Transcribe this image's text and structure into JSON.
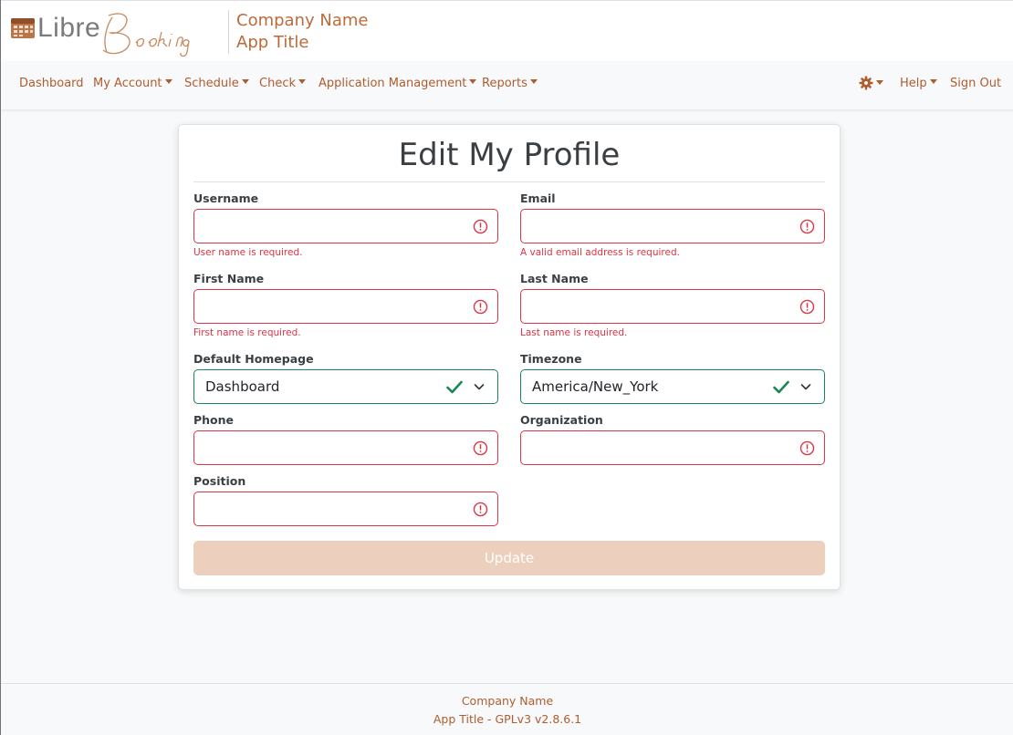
{
  "header": {
    "logo": {
      "brand_plain": "Libre",
      "brand_script": "Booking",
      "icon": "calendar-icon"
    },
    "company_name": "Company Name",
    "app_title": "App Title"
  },
  "nav": {
    "left": [
      {
        "label": "Dashboard",
        "dropdown": false
      },
      {
        "label": "My Account",
        "dropdown": true
      },
      {
        "label": "Schedule",
        "dropdown": true
      },
      {
        "label": "Check",
        "dropdown": true
      },
      {
        "label": "Application Management",
        "dropdown": true
      },
      {
        "label": "Reports",
        "dropdown": true
      }
    ],
    "right": {
      "settings_icon": "gear-icon",
      "help": "Help",
      "sign_out": "Sign Out"
    }
  },
  "form": {
    "title": "Edit My Profile",
    "fields": {
      "username": {
        "label": "Username",
        "value": "",
        "state": "invalid",
        "error": "User name is required."
      },
      "email": {
        "label": "Email",
        "value": "",
        "state": "invalid",
        "error": "A valid email address is required."
      },
      "first_name": {
        "label": "First Name",
        "value": "",
        "state": "invalid",
        "error": "First name is required."
      },
      "last_name": {
        "label": "Last Name",
        "value": "",
        "state": "invalid",
        "error": "Last name is required."
      },
      "default_homepage": {
        "label": "Default Homepage",
        "value": "Dashboard",
        "state": "valid"
      },
      "timezone": {
        "label": "Timezone",
        "value": "America/New_York",
        "state": "valid"
      },
      "phone": {
        "label": "Phone",
        "value": "",
        "state": "invalid"
      },
      "organization": {
        "label": "Organization",
        "value": "",
        "state": "invalid"
      },
      "position": {
        "label": "Position",
        "value": "",
        "state": "invalid"
      }
    },
    "submit_label": "Update"
  },
  "footer": {
    "company": "Company Name",
    "app_version": "App Title - GPLv3 v2.8.6.1"
  },
  "colors": {
    "accent": "#b05c2e",
    "invalid": "#dc3545",
    "valid": "#198754",
    "button_disabled": "#eccfbd"
  }
}
